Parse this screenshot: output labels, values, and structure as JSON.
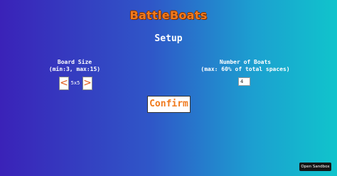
{
  "app": {
    "logo_text": "BattleBoats"
  },
  "setup": {
    "heading": "Setup",
    "board_size": {
      "label_line1": "Board Size",
      "label_line2": "(min:3, max:15)",
      "decrease_label": "<",
      "increase_label": ">",
      "value": "5x5"
    },
    "boats": {
      "label_line1": "Number of Boats",
      "label_line2": "(max: 60% of total spaces)",
      "value": "4"
    },
    "confirm_label": "Confirm"
  },
  "sandbox": {
    "label": "Open Sandbox"
  },
  "colors": {
    "accent": "#f07a1e",
    "gradient_start": "#3a22b8",
    "gradient_end": "#10c4cc"
  }
}
